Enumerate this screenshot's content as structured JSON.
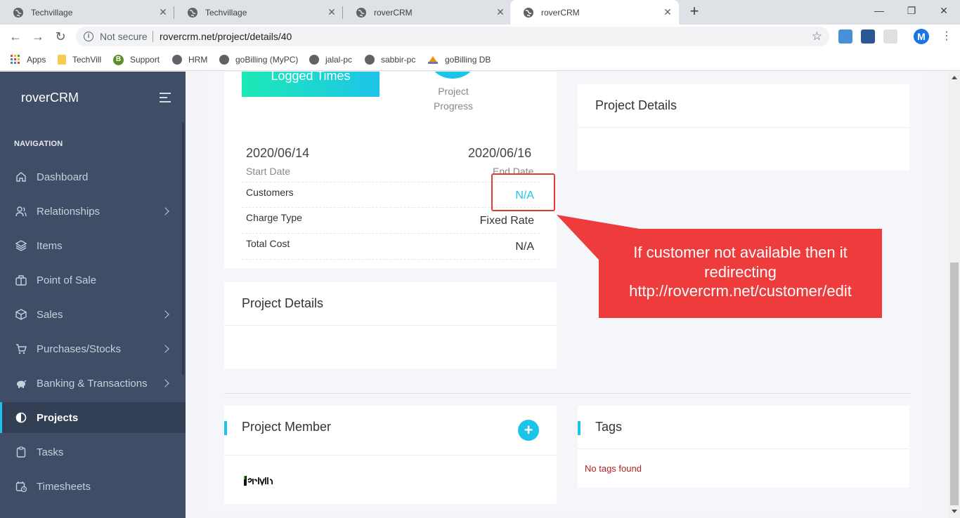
{
  "browser": {
    "tabs": [
      {
        "title": "Techvillage",
        "active": false
      },
      {
        "title": "Techvillage",
        "active": false
      },
      {
        "title": "roverCRM",
        "active": false
      },
      {
        "title": "roverCRM",
        "active": true
      }
    ],
    "security_label": "Not secure",
    "url": "rovercrm.net/project/details/40",
    "profile_initial": "M",
    "bookmarks": [
      {
        "label": "Apps",
        "icon": "apps-grid-icon"
      },
      {
        "label": "TechVill",
        "icon": "folder-icon"
      },
      {
        "label": "Support",
        "icon": "support-b-icon"
      },
      {
        "label": "HRM",
        "icon": "globe-icon"
      },
      {
        "label": "goBilling (MyPC)",
        "icon": "globe-icon"
      },
      {
        "label": "jalal-pc",
        "icon": "globe-icon"
      },
      {
        "label": "sabbir-pc",
        "icon": "globe-icon"
      },
      {
        "label": "goBilling DB",
        "icon": "pma-icon"
      }
    ]
  },
  "sidebar": {
    "brand": "roverCRM",
    "nav_label": "NAVIGATION",
    "items": [
      {
        "label": "Dashboard",
        "icon": "home-icon",
        "has_children": false,
        "active": false
      },
      {
        "label": "Relationships",
        "icon": "users-icon",
        "has_children": true,
        "active": false
      },
      {
        "label": "Items",
        "icon": "layers-icon",
        "has_children": false,
        "active": false
      },
      {
        "label": "Point of Sale",
        "icon": "briefcase-icon",
        "has_children": false,
        "active": false
      },
      {
        "label": "Sales",
        "icon": "box-icon",
        "has_children": true,
        "active": false
      },
      {
        "label": "Purchases/Stocks",
        "icon": "cart-icon",
        "has_children": true,
        "active": false
      },
      {
        "label": "Banking & Transactions",
        "icon": "piggy-bank-icon",
        "has_children": true,
        "active": false
      },
      {
        "label": "Projects",
        "icon": "half-circle-icon",
        "has_children": false,
        "active": true
      },
      {
        "label": "Tasks",
        "icon": "clipboard-icon",
        "has_children": false,
        "active": false
      },
      {
        "label": "Timesheets",
        "icon": "calendar-clock-icon",
        "has_children": false,
        "active": false
      }
    ]
  },
  "overview": {
    "logged_times_label": "Logged Times",
    "progress_label_line1": "Project",
    "progress_label_line2": "Progress",
    "start_date": "2020/06/14",
    "start_date_label": "Start Date",
    "end_date": "2020/06/16",
    "end_date_label": "End Date",
    "rows": [
      {
        "label": "Customers",
        "value": "N/A",
        "link": true
      },
      {
        "label": "Charge Type",
        "value": "Fixed Rate",
        "link": false
      },
      {
        "label": "Total Cost",
        "value": "N/A",
        "link": false
      }
    ]
  },
  "project_details_left": {
    "title": "Project Details"
  },
  "project_details_right": {
    "title": "Project Details"
  },
  "project_member": {
    "title": "Project Member",
    "add_label": "+"
  },
  "tags": {
    "title": "Tags",
    "empty_text": "No tags found"
  },
  "annotation": {
    "line1": "If customer not available then it",
    "line2": "redirecting",
    "line3": "http://rovercrm.net/customer/edit"
  },
  "colors": {
    "sidebar_bg": "#3f4d67",
    "accent": "#1dc4e9",
    "callout_red": "#ee3b3b"
  }
}
